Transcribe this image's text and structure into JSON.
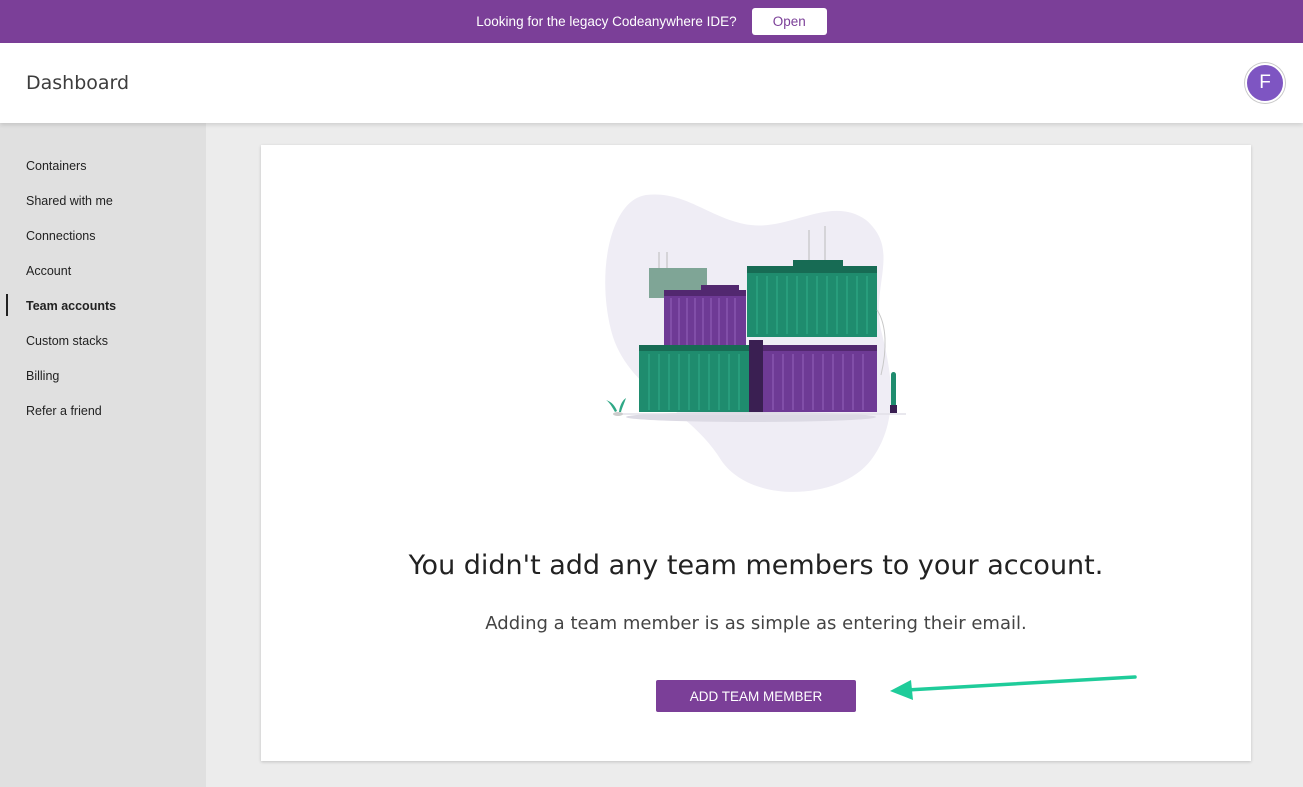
{
  "banner": {
    "text": "Looking for the legacy Codeanywhere IDE?",
    "open_label": "Open"
  },
  "header": {
    "title": "Dashboard",
    "avatar_initial": "F"
  },
  "sidebar": {
    "items": [
      {
        "label": "Containers",
        "active": false
      },
      {
        "label": "Shared with me",
        "active": false
      },
      {
        "label": "Connections",
        "active": false
      },
      {
        "label": "Account",
        "active": false
      },
      {
        "label": "Team accounts",
        "active": true
      },
      {
        "label": "Custom stacks",
        "active": false
      },
      {
        "label": "Billing",
        "active": false
      },
      {
        "label": "Refer a friend",
        "active": false
      }
    ]
  },
  "main": {
    "illustration_icon": "shipping-containers-illustration",
    "empty_title": "You didn't add any team members to your account.",
    "empty_subtitle": "Adding a team member is as simple as entering their email.",
    "add_button_label": "ADD TEAM MEMBER"
  },
  "annotation": {
    "arrow_icon": "arrow-left-icon",
    "arrow_color": "#1fcc9a"
  },
  "colors": {
    "brand_purple": "#7b3f98",
    "avatar_purple": "#7e55c2",
    "container_green": "#1f8c6e",
    "container_purple": "#6e3a95",
    "sidebar_bg": "#e0e0e0",
    "content_bg": "#ececec"
  }
}
